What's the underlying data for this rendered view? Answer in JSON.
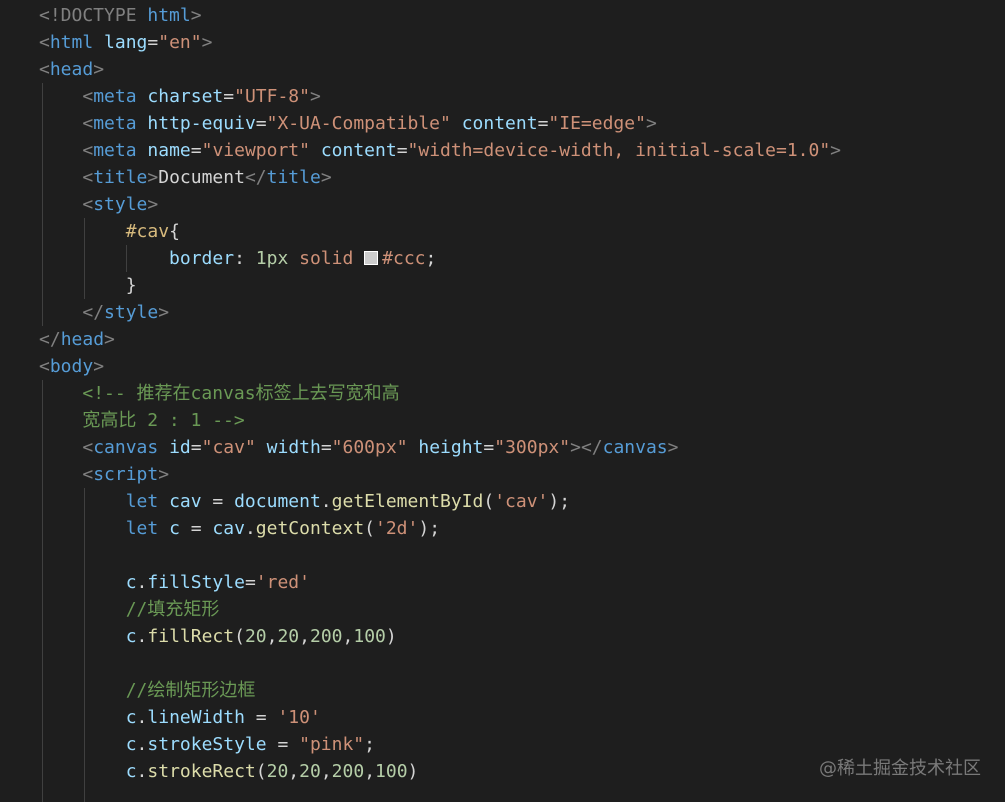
{
  "editor": {
    "lines": [
      [
        {
          "t": "<!DOCTYPE ",
          "c": "punct"
        },
        {
          "t": "html",
          "c": "tag"
        },
        {
          "t": ">",
          "c": "punct"
        }
      ],
      [
        {
          "t": "<",
          "c": "punct"
        },
        {
          "t": "html",
          "c": "tag"
        },
        {
          "t": " ",
          "c": "text"
        },
        {
          "t": "lang",
          "c": "attr"
        },
        {
          "t": "=",
          "c": "text"
        },
        {
          "t": "\"en\"",
          "c": "str"
        },
        {
          "t": ">",
          "c": "punct"
        }
      ],
      [
        {
          "t": "<",
          "c": "punct"
        },
        {
          "t": "head",
          "c": "tag"
        },
        {
          "t": ">",
          "c": "punct"
        }
      ],
      [
        {
          "t": "    ",
          "c": "text"
        },
        {
          "t": "<",
          "c": "punct"
        },
        {
          "t": "meta",
          "c": "tag"
        },
        {
          "t": " ",
          "c": "text"
        },
        {
          "t": "charset",
          "c": "attr"
        },
        {
          "t": "=",
          "c": "text"
        },
        {
          "t": "\"UTF-8\"",
          "c": "str"
        },
        {
          "t": ">",
          "c": "punct"
        }
      ],
      [
        {
          "t": "    ",
          "c": "text"
        },
        {
          "t": "<",
          "c": "punct"
        },
        {
          "t": "meta",
          "c": "tag"
        },
        {
          "t": " ",
          "c": "text"
        },
        {
          "t": "http-equiv",
          "c": "attr"
        },
        {
          "t": "=",
          "c": "text"
        },
        {
          "t": "\"X-UA-Compatible\"",
          "c": "str"
        },
        {
          "t": " ",
          "c": "text"
        },
        {
          "t": "content",
          "c": "attr"
        },
        {
          "t": "=",
          "c": "text"
        },
        {
          "t": "\"IE=edge\"",
          "c": "str"
        },
        {
          "t": ">",
          "c": "punct"
        }
      ],
      [
        {
          "t": "    ",
          "c": "text"
        },
        {
          "t": "<",
          "c": "punct"
        },
        {
          "t": "meta",
          "c": "tag"
        },
        {
          "t": " ",
          "c": "text"
        },
        {
          "t": "name",
          "c": "attr"
        },
        {
          "t": "=",
          "c": "text"
        },
        {
          "t": "\"viewport\"",
          "c": "str"
        },
        {
          "t": " ",
          "c": "text"
        },
        {
          "t": "content",
          "c": "attr"
        },
        {
          "t": "=",
          "c": "text"
        },
        {
          "t": "\"width=device-width, initial-scale=1.0\"",
          "c": "str"
        },
        {
          "t": ">",
          "c": "punct"
        }
      ],
      [
        {
          "t": "    ",
          "c": "text"
        },
        {
          "t": "<",
          "c": "punct"
        },
        {
          "t": "title",
          "c": "tag"
        },
        {
          "t": ">",
          "c": "punct"
        },
        {
          "t": "Document",
          "c": "text"
        },
        {
          "t": "</",
          "c": "punct"
        },
        {
          "t": "title",
          "c": "tag"
        },
        {
          "t": ">",
          "c": "punct"
        }
      ],
      [
        {
          "t": "    ",
          "c": "text"
        },
        {
          "t": "<",
          "c": "punct"
        },
        {
          "t": "style",
          "c": "tag"
        },
        {
          "t": ">",
          "c": "punct"
        }
      ],
      [
        {
          "t": "        ",
          "c": "text"
        },
        {
          "t": "#cav",
          "c": "css-id"
        },
        {
          "t": "{",
          "c": "brace"
        }
      ],
      [
        {
          "t": "            ",
          "c": "text"
        },
        {
          "t": "border",
          "c": "css-prop"
        },
        {
          "t": ": ",
          "c": "text"
        },
        {
          "t": "1px",
          "c": "css-num"
        },
        {
          "t": " ",
          "c": "text"
        },
        {
          "t": "solid",
          "c": "css-val"
        },
        {
          "t": " ",
          "c": "text"
        },
        {
          "t": "",
          "c": "swatch"
        },
        {
          "t": "#ccc",
          "c": "css-val"
        },
        {
          "t": ";",
          "c": "text"
        }
      ],
      [
        {
          "t": "        ",
          "c": "text"
        },
        {
          "t": "}",
          "c": "brace"
        }
      ],
      [
        {
          "t": "    ",
          "c": "text"
        },
        {
          "t": "</",
          "c": "punct"
        },
        {
          "t": "style",
          "c": "tag"
        },
        {
          "t": ">",
          "c": "punct"
        }
      ],
      [
        {
          "t": "</",
          "c": "punct"
        },
        {
          "t": "head",
          "c": "tag"
        },
        {
          "t": ">",
          "c": "punct"
        }
      ],
      [
        {
          "t": "<",
          "c": "punct"
        },
        {
          "t": "body",
          "c": "tag"
        },
        {
          "t": ">",
          "c": "punct"
        }
      ],
      [
        {
          "t": "    ",
          "c": "text"
        },
        {
          "t": "<!-- 推荐在canvas标签上去写宽和高",
          "c": "comment"
        }
      ],
      [
        {
          "t": "    ",
          "c": "text"
        },
        {
          "t": "宽高比 2 : 1 -->",
          "c": "comment"
        }
      ],
      [
        {
          "t": "    ",
          "c": "text"
        },
        {
          "t": "<",
          "c": "punct"
        },
        {
          "t": "canvas",
          "c": "tag"
        },
        {
          "t": " ",
          "c": "text"
        },
        {
          "t": "id",
          "c": "attr"
        },
        {
          "t": "=",
          "c": "text"
        },
        {
          "t": "\"cav\"",
          "c": "str"
        },
        {
          "t": " ",
          "c": "text"
        },
        {
          "t": "width",
          "c": "attr"
        },
        {
          "t": "=",
          "c": "text"
        },
        {
          "t": "\"600px\"",
          "c": "str"
        },
        {
          "t": " ",
          "c": "text"
        },
        {
          "t": "height",
          "c": "attr"
        },
        {
          "t": "=",
          "c": "text"
        },
        {
          "t": "\"300px\"",
          "c": "str"
        },
        {
          "t": "></",
          "c": "punct"
        },
        {
          "t": "canvas",
          "c": "tag"
        },
        {
          "t": ">",
          "c": "punct"
        }
      ],
      [
        {
          "t": "    ",
          "c": "text"
        },
        {
          "t": "<",
          "c": "punct"
        },
        {
          "t": "script",
          "c": "tag"
        },
        {
          "t": ">",
          "c": "punct"
        }
      ],
      [
        {
          "t": "        ",
          "c": "text"
        },
        {
          "t": "let",
          "c": "kw"
        },
        {
          "t": " ",
          "c": "text"
        },
        {
          "t": "cav",
          "c": "var"
        },
        {
          "t": " = ",
          "c": "op"
        },
        {
          "t": "document",
          "c": "var"
        },
        {
          "t": ".",
          "c": "op"
        },
        {
          "t": "getElementById",
          "c": "fn"
        },
        {
          "t": "(",
          "c": "op"
        },
        {
          "t": "'cav'",
          "c": "str"
        },
        {
          "t": ");",
          "c": "op"
        }
      ],
      [
        {
          "t": "        ",
          "c": "text"
        },
        {
          "t": "let",
          "c": "kw"
        },
        {
          "t": " ",
          "c": "text"
        },
        {
          "t": "c",
          "c": "var"
        },
        {
          "t": " = ",
          "c": "op"
        },
        {
          "t": "cav",
          "c": "var"
        },
        {
          "t": ".",
          "c": "op"
        },
        {
          "t": "getContext",
          "c": "fn"
        },
        {
          "t": "(",
          "c": "op"
        },
        {
          "t": "'2d'",
          "c": "str"
        },
        {
          "t": ");",
          "c": "op"
        }
      ],
      [],
      [
        {
          "t": "        ",
          "c": "text"
        },
        {
          "t": "c",
          "c": "var"
        },
        {
          "t": ".",
          "c": "op"
        },
        {
          "t": "fillStyle",
          "c": "var"
        },
        {
          "t": "=",
          "c": "op"
        },
        {
          "t": "'red'",
          "c": "str"
        }
      ],
      [
        {
          "t": "        ",
          "c": "text"
        },
        {
          "t": "//填充矩形",
          "c": "comment"
        }
      ],
      [
        {
          "t": "        ",
          "c": "text"
        },
        {
          "t": "c",
          "c": "var"
        },
        {
          "t": ".",
          "c": "op"
        },
        {
          "t": "fillRect",
          "c": "fn"
        },
        {
          "t": "(",
          "c": "op"
        },
        {
          "t": "20",
          "c": "num"
        },
        {
          "t": ",",
          "c": "op"
        },
        {
          "t": "20",
          "c": "num"
        },
        {
          "t": ",",
          "c": "op"
        },
        {
          "t": "200",
          "c": "num"
        },
        {
          "t": ",",
          "c": "op"
        },
        {
          "t": "100",
          "c": "num"
        },
        {
          "t": ")",
          "c": "op"
        }
      ],
      [],
      [
        {
          "t": "        ",
          "c": "text"
        },
        {
          "t": "//绘制矩形边框",
          "c": "comment"
        }
      ],
      [
        {
          "t": "        ",
          "c": "text"
        },
        {
          "t": "c",
          "c": "var"
        },
        {
          "t": ".",
          "c": "op"
        },
        {
          "t": "lineWidth",
          "c": "var"
        },
        {
          "t": " = ",
          "c": "op"
        },
        {
          "t": "'10'",
          "c": "str"
        }
      ],
      [
        {
          "t": "        ",
          "c": "text"
        },
        {
          "t": "c",
          "c": "var"
        },
        {
          "t": ".",
          "c": "op"
        },
        {
          "t": "strokeStyle",
          "c": "var"
        },
        {
          "t": " = ",
          "c": "op"
        },
        {
          "t": "\"pink\"",
          "c": "str"
        },
        {
          "t": ";",
          "c": "op"
        }
      ],
      [
        {
          "t": "        ",
          "c": "text"
        },
        {
          "t": "c",
          "c": "var"
        },
        {
          "t": ".",
          "c": "op"
        },
        {
          "t": "strokeRect",
          "c": "fn"
        },
        {
          "t": "(",
          "c": "op"
        },
        {
          "t": "20",
          "c": "num"
        },
        {
          "t": ",",
          "c": "op"
        },
        {
          "t": "20",
          "c": "num"
        },
        {
          "t": ",",
          "c": "op"
        },
        {
          "t": "200",
          "c": "num"
        },
        {
          "t": ",",
          "c": "op"
        },
        {
          "t": "100",
          "c": "num"
        },
        {
          "t": ")",
          "c": "op"
        }
      ]
    ]
  },
  "watermark": "@稀土掘金技术社区",
  "colors": {
    "background": "#1e1e1e",
    "tag": "#569cd6",
    "attribute": "#9cdcfe",
    "string": "#ce9178",
    "comment": "#6a9955",
    "function": "#dcdcaa",
    "number": "#b5cea8",
    "selector": "#d7ba7d",
    "swatch": "#cccccc"
  }
}
